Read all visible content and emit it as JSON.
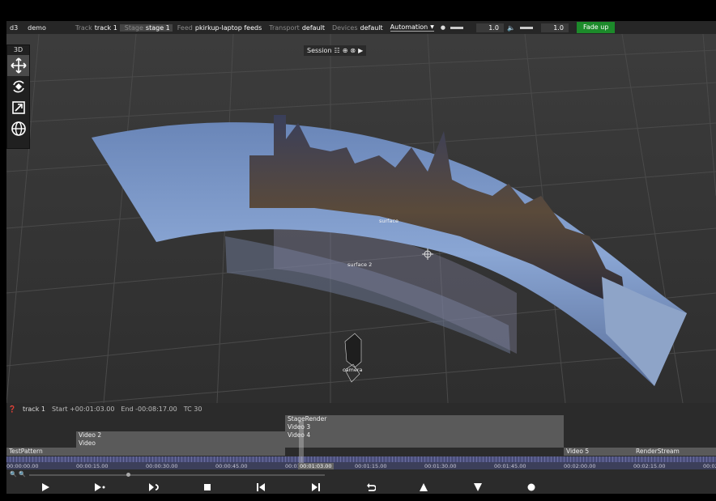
{
  "menubar": {
    "d3": "d3",
    "project": "demo",
    "track_label": "Track",
    "track_value": "track 1",
    "stage_label": "Stage",
    "stage_value": "stage 1",
    "feed_label": "Feed",
    "feed_value": "pkirkup-laptop feeds",
    "transport_label": "Transport",
    "transport_value": "default",
    "devices_label": "Devices",
    "devices_value": "default",
    "automation": "Automation",
    "brightness_value": "1.0",
    "volume_value": "1.0",
    "fade_button": "Fade up",
    "colors": {
      "fade": "#1c8a2a"
    }
  },
  "toolbox": {
    "title": "3D",
    "tools": [
      "move-icon",
      "rotate-icon",
      "scale-icon",
      "globe-icon"
    ]
  },
  "session": {
    "label": "Session"
  },
  "viewport": {
    "surface1_label": "surface",
    "surface2_label": "surface 2",
    "camera_label": "camera"
  },
  "timeline": {
    "track": "track 1",
    "start": "Start +00:01:03.00",
    "end": "End -00:08:17.00",
    "tc": "TC 30",
    "clips": {
      "stagerender": "StageRender",
      "video3": "Video 3",
      "video2": "Video 2",
      "video4": "Video 4",
      "video": "Video",
      "testpattern": "TestPattern",
      "video5": "Video 5",
      "renderstream": "RenderStream"
    },
    "ticks": [
      "00:00:00.00",
      "00:00:15.00",
      "00:00:30.00",
      "00:00:45.00",
      "00:01:00.00",
      "00:01:15.00",
      "00:01:30.00",
      "00:01:45.00",
      "00:02:00.00",
      "00:02:15.00",
      "00:02:3"
    ],
    "playhead": "00:01:03.00"
  },
  "transport": [
    "play-icon",
    "play-to-end-icon",
    "loop-icon",
    "stop-icon",
    "previous-section-icon",
    "next-section-icon",
    "return-icon",
    "up-icon",
    "down-icon",
    "record-icon"
  ]
}
